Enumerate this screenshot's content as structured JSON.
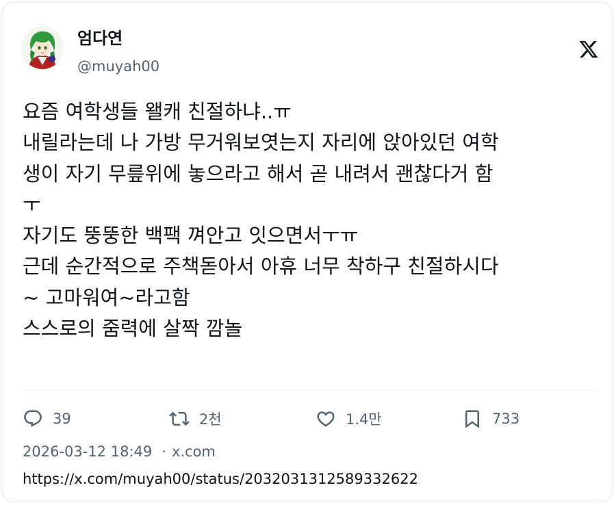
{
  "author": {
    "display_name": "엄다연",
    "handle": "@muyah00",
    "avatar_icon": "anime-character-avatar"
  },
  "brand": {
    "logo_icon": "x-logo-icon"
  },
  "tweet": {
    "lines": [
      "요즘 여학생들 왤캐 친절하냐..ㅠ",
      "내릴라는데 나 가방 무거워보엿는지 자리에 앉아있던 여학",
      "생이 자기 무릎위에 놓으라고 해서 곧 내려서 괜찮다거 함",
      "ㅜ",
      "자기도 뚱뚱한 백팩 껴안고 잇으면서ㅜㅠ",
      "근데 순간적으로 주책돋아서 아휴 너무 착하구 친절하시다",
      "~ 고마워여~라고함",
      "스스로의 줌력에 살짝 깜놀"
    ]
  },
  "actions": {
    "replies": "39",
    "reposts": "2천",
    "likes": "1.4만",
    "bookmarks": "733"
  },
  "meta": {
    "timestamp": "2026-03-12 18:49",
    "separator": "·",
    "source": "x.com"
  },
  "url": "https://x.com/muyah00/status/2032031312589332622",
  "colors": {
    "text": "#0f1419",
    "secondary": "#536471",
    "border": "#e3e7ea"
  }
}
